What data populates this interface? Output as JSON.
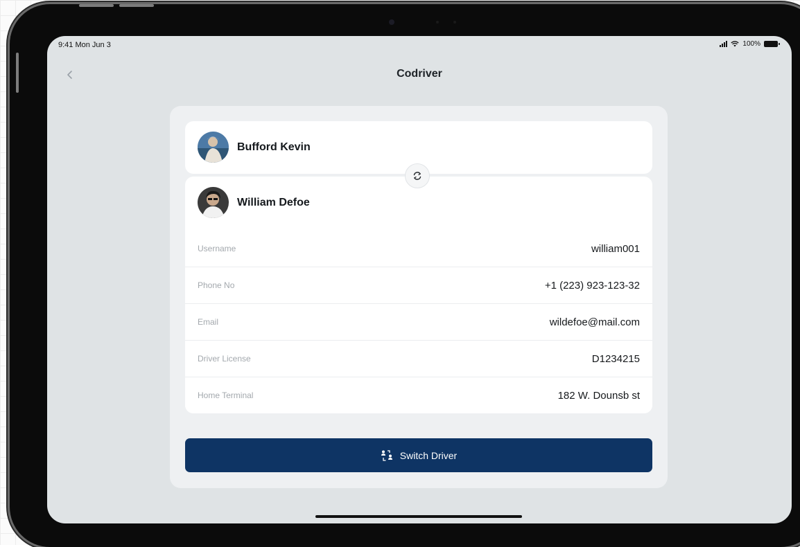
{
  "status_bar": {
    "time": "9:41 Mon Jun 3",
    "battery": "100%"
  },
  "nav": {
    "back_icon": "chevron-left-icon",
    "title": "Codriver"
  },
  "drivers": {
    "primary": {
      "name": "Bufford Kevin"
    },
    "codriver": {
      "name": "William Defoe"
    }
  },
  "details": [
    {
      "label": "Username",
      "value": "william001"
    },
    {
      "label": "Phone No",
      "value": "+1 (223) 923-123-32"
    },
    {
      "label": "Email",
      "value": "wildefoe@mail.com"
    },
    {
      "label": "Driver License",
      "value": "D1234215"
    },
    {
      "label": "Home Terminal",
      "value": "182 W. Dounsb st"
    }
  ],
  "actions": {
    "switch_label": "Switch Driver",
    "switch_icon": "swap-users-icon",
    "swap_icon": "refresh-icon"
  },
  "colors": {
    "primary_button": "#0e3464",
    "screen_bg": "#dfe3e5",
    "panel_bg": "#eef0f2"
  }
}
